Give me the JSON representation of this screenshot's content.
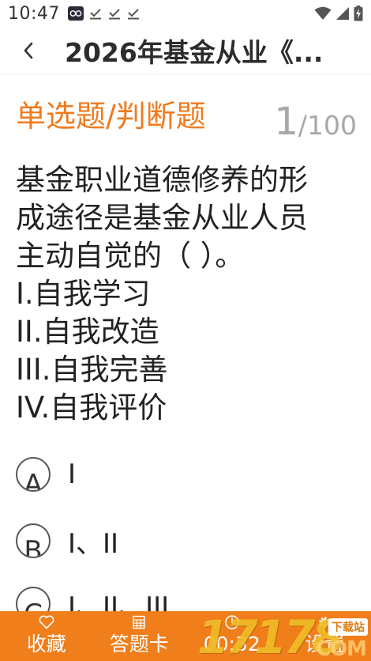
{
  "status_bar": {
    "time": "10:47",
    "icons": [
      "app-notification-icon",
      "download-done-icon",
      "download-done-icon",
      "download-done-icon",
      "wifi-icon",
      "signal-icon",
      "battery-charging-icon"
    ]
  },
  "nav": {
    "back_icon": "chevron-left-icon",
    "title": "2026年基金从业《..."
  },
  "question": {
    "type": "单选题/判断题",
    "current": "1",
    "total": "/100",
    "stem_lines": [
      "基金职业道德修养的形",
      "成途径是基金从业人员",
      "主动自觉的（ ）。",
      "I.自我学习",
      "II.自我改造",
      "III.自我完善",
      "IV.自我评价"
    ],
    "options": [
      {
        "letter": "A",
        "text": "I"
      },
      {
        "letter": "B",
        "text": "I、II"
      },
      {
        "letter": "C",
        "text": "I、II、III"
      }
    ]
  },
  "bottom_bar": {
    "tabs": [
      {
        "icon": "heart-icon",
        "label": "收藏"
      },
      {
        "icon": "answer-sheet-icon",
        "label": "答题卡"
      },
      {
        "icon": "clock-icon",
        "label": "00:32"
      },
      {
        "icon": "gear-icon",
        "label": "设置"
      }
    ]
  },
  "watermark": {
    "digits": "17178",
    "tag": "下载站",
    "suffix": "COM"
  },
  "colors": {
    "accent": "#f07b1e",
    "bottom_bar": "#f07e1a",
    "counter_gray": "#a8a8a8"
  }
}
